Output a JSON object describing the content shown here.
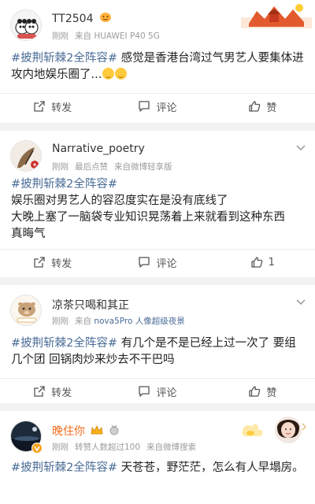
{
  "posts": [
    {
      "username": "TT2504",
      "meta_time": "刚刚",
      "meta_source": "来自 HUAWEI P40 5G",
      "tag": "#披荆斩棘2全阵容#",
      "text": " 感觉是香港台湾过气男艺人要集体进攻内地娱乐圈了...",
      "actions": {
        "repost": "转发",
        "comment": "评论",
        "like": "赞"
      }
    },
    {
      "username": "Narrative_poetry",
      "meta_time": "刚刚",
      "meta_extra": "最后点赞",
      "meta_source": "来自微博轻享版",
      "tag": "#披荆斩棘2全阵容#",
      "lines": [
        "娱乐圈对男艺人的容忍度实在是没有底线了",
        "大晚上塞了一脑袋专业知识晃荡着上来就看到这种东西",
        "真晦气"
      ],
      "actions": {
        "repost": "转发",
        "comment": "评论",
        "like": "1"
      }
    },
    {
      "username": "凉茶只喝和其正",
      "meta_time": "刚刚",
      "meta_source_prefix": "来自",
      "meta_source_link": "nova5Pro 人像超级夜景",
      "tag": "#披荆斩棘2全阵容#",
      "text": " 有几个是不是已经上过一次了 要组几个团 回锅肉炒来炒去不干巴吗",
      "actions": {
        "repost": "转发",
        "comment": "评论",
        "like": "赞"
      }
    },
    {
      "username": "晚住你",
      "meta_time": "刚刚",
      "meta_extra": "转赞人数超过100",
      "meta_source": "来自微博搜索",
      "tag": "#披荆斩棘2全阵容#",
      "text": " 天苍苍，野茫茫，怎么有人早塌房。"
    }
  ],
  "colors": {
    "link": "#4a6c96",
    "vip_orange": "#f36b1b",
    "meta_gray": "#9b9b9b",
    "background": "#f2f2f2"
  },
  "icons": [
    "repost-icon",
    "comment-icon",
    "like-icon",
    "chevron-down-icon",
    "verified-badge-icon"
  ]
}
